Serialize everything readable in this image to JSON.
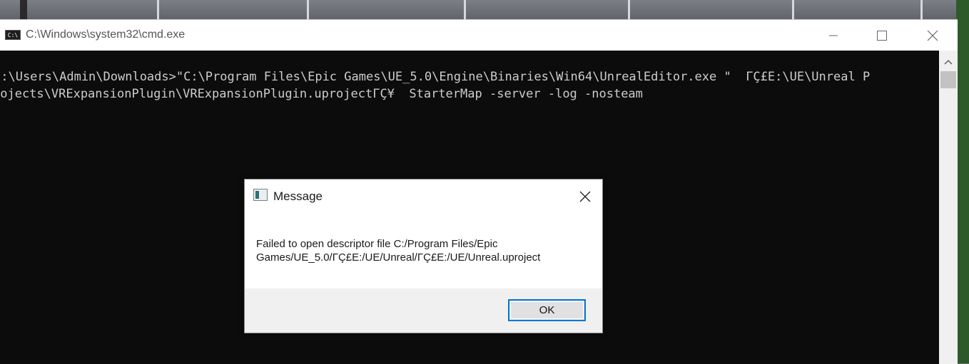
{
  "window": {
    "title": "C:\\Windows\\system32\\cmd.exe",
    "icon_label": "C:\\"
  },
  "console": {
    "lines": [
      "C:\\Users\\Admin\\Downloads>\"C:\\Program Files\\Epic Games\\UE_5.0\\Engine\\Binaries\\Win64\\UnrealEditor.exe \"  ΓÇ£E:\\UE\\Unreal P",
      "rojects\\VRExpansionPlugin\\VRExpansionPlugin.uprojectΓÇ¥  StarterMap -server -log -nosteam"
    ]
  },
  "dialog": {
    "title": "Message",
    "message_line1": "Failed to open descriptor file C:/Program Files/Epic",
    "message_line2": "Games/UE_5.0/ΓÇ£E:/UE/Unreal/ΓÇ£E:/UE/Unreal.uproject",
    "ok_label": "OK"
  },
  "colors": {
    "console_bg": "#0c0c0c",
    "console_fg": "#cccccc",
    "focus_border": "#0078d7"
  },
  "icons": [
    "cmd-app-icon",
    "minimize-icon",
    "maximize-icon",
    "close-icon",
    "scroll-up-icon",
    "message-app-icon",
    "dialog-close-icon"
  ]
}
